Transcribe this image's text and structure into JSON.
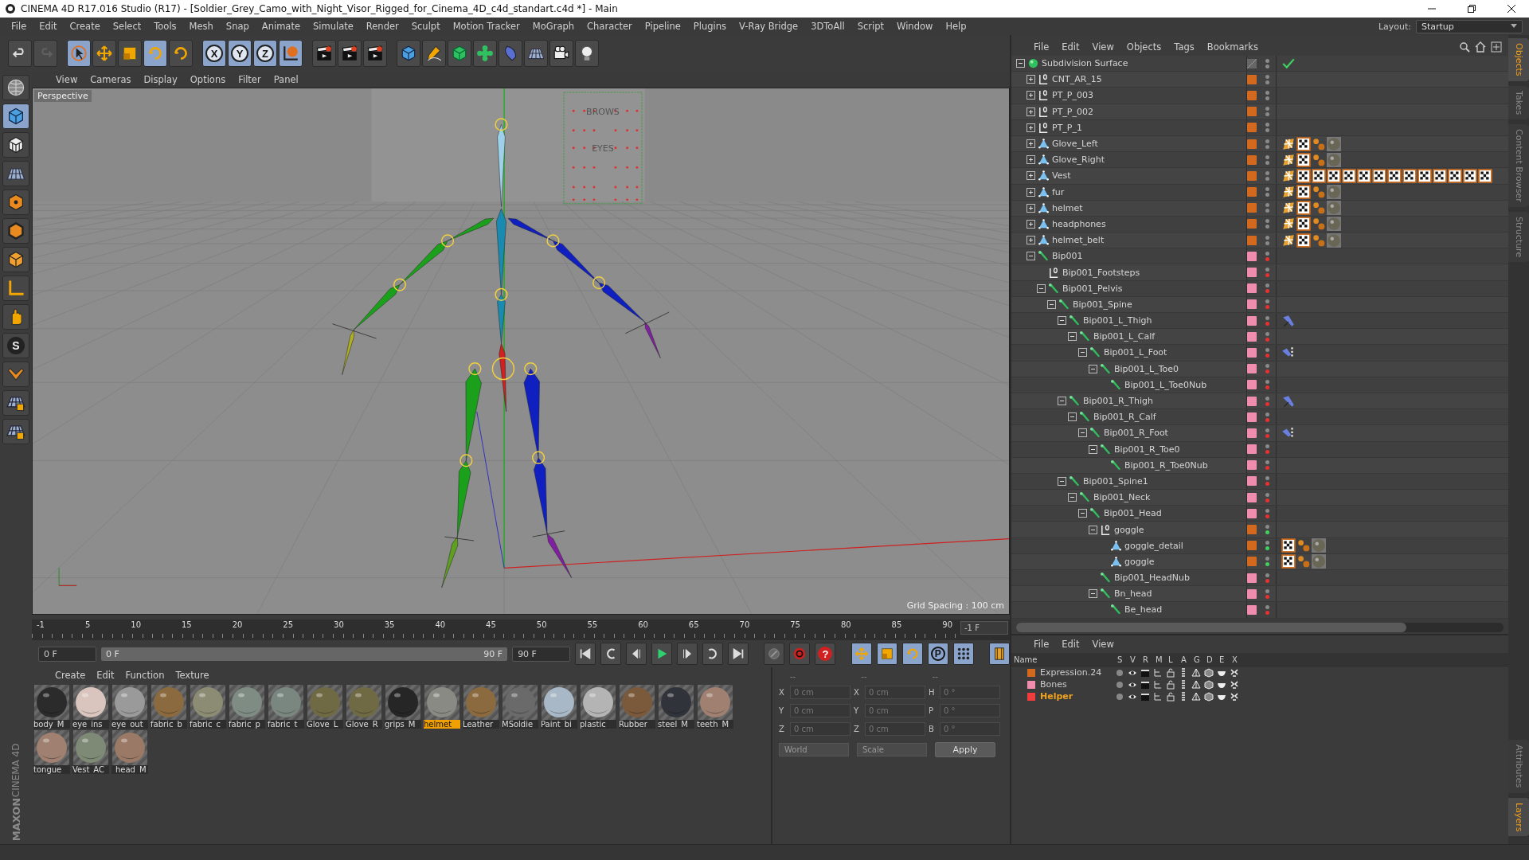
{
  "window": {
    "title": "CINEMA 4D R17.016 Studio (R17) - [Soldier_Grey_Camo_with_Night_Visor_Rigged_for_Cinema_4D_c4d_standart.c4d *] - Main"
  },
  "menu": [
    "File",
    "Edit",
    "Create",
    "Select",
    "Tools",
    "Mesh",
    "Snap",
    "Animate",
    "Simulate",
    "Render",
    "Sculpt",
    "Motion Tracker",
    "MoGraph",
    "Character",
    "Pipeline",
    "Plugins",
    "V-Ray Bridge",
    "3DToAll",
    "Script",
    "Window",
    "Help"
  ],
  "layout": {
    "label": "Layout:",
    "value": "Startup"
  },
  "toolbar": [
    {
      "kind": "undo",
      "selected": false
    },
    {
      "kind": "redo",
      "selected": false,
      "disabled": true
    },
    {
      "kind": "sep"
    },
    {
      "kind": "select",
      "selected": true
    },
    {
      "kind": "move",
      "selected": false
    },
    {
      "kind": "scale",
      "selected": false
    },
    {
      "kind": "rotate",
      "selected": true
    },
    {
      "kind": "rotate",
      "selected": false
    },
    {
      "kind": "sep"
    },
    {
      "kind": "axis",
      "label": "X",
      "selected": true
    },
    {
      "kind": "axis",
      "label": "Y",
      "selected": true
    },
    {
      "kind": "axis",
      "label": "Z",
      "selected": true
    },
    {
      "kind": "world",
      "selected": true
    },
    {
      "kind": "sep"
    },
    {
      "kind": "render",
      "selected": false
    },
    {
      "kind": "render",
      "selected": false
    },
    {
      "kind": "render",
      "selected": false
    },
    {
      "kind": "sep"
    },
    {
      "kind": "cube",
      "selected": false
    },
    {
      "kind": "pen",
      "selected": false
    },
    {
      "kind": "subdivision",
      "selected": false
    },
    {
      "kind": "cloner",
      "selected": false
    },
    {
      "kind": "deformer",
      "selected": false
    },
    {
      "kind": "floor",
      "selected": false
    },
    {
      "kind": "camera",
      "selected": false
    },
    {
      "kind": "light",
      "selected": false
    }
  ],
  "left_tools": [
    {
      "kind": "globe",
      "selected": false
    },
    {
      "kind": "cube",
      "selected": true
    },
    {
      "kind": "checker",
      "selected": false
    },
    {
      "kind": "floor",
      "selected": false
    },
    {
      "kind": "points",
      "selected": false
    },
    {
      "kind": "edges",
      "selected": false
    },
    {
      "kind": "polygons",
      "selected": false
    },
    {
      "kind": "axis-l",
      "selected": false
    },
    {
      "kind": "tweak",
      "selected": false
    },
    {
      "kind": "snap",
      "label": "S",
      "selected": false
    },
    {
      "kind": "magnet",
      "selected": false
    },
    {
      "kind": "grid-lock",
      "selected": false
    },
    {
      "kind": "grid-lock",
      "selected": false
    }
  ],
  "viewport": {
    "menu": [
      "View",
      "Cameras",
      "Display",
      "Options",
      "Filter",
      "Panel"
    ],
    "camera": "Perspective",
    "grid_spacing": "Grid Spacing : 100 cm",
    "rig_labels": [
      "BROWS",
      "EYES"
    ]
  },
  "timeline": {
    "ticks": [
      "-1",
      "5",
      "10",
      "15",
      "20",
      "25",
      "30",
      "35",
      "40",
      "45",
      "50",
      "55",
      "60",
      "65",
      "70",
      "75",
      "80",
      "85",
      "90"
    ],
    "current": "-1 F",
    "start": "0 F",
    "range_start": "0 F",
    "range_end": "90 F",
    "end": "90 F"
  },
  "transport": [
    {
      "kind": "first",
      "selected": false
    },
    {
      "kind": "prev-key",
      "selected": false
    },
    {
      "kind": "prev",
      "selected": false
    },
    {
      "kind": "play",
      "selected": false
    },
    {
      "kind": "next",
      "selected": false
    },
    {
      "kind": "next-key",
      "selected": false
    },
    {
      "kind": "last",
      "selected": false
    },
    {
      "kind": "sep"
    },
    {
      "kind": "key",
      "selected": false
    },
    {
      "kind": "record",
      "selected": false
    },
    {
      "kind": "autokey",
      "label": "?",
      "selected": false
    },
    {
      "kind": "sep"
    },
    {
      "kind": "move",
      "selected": true
    },
    {
      "kind": "scale",
      "selected": true
    },
    {
      "kind": "rotate",
      "selected": true
    },
    {
      "kind": "param",
      "label": "P",
      "selected": true
    },
    {
      "kind": "dots",
      "selected": true
    },
    {
      "kind": "sep"
    },
    {
      "kind": "film",
      "selected": true
    }
  ],
  "materials": {
    "menu": [
      "Create",
      "Edit",
      "Function",
      "Texture"
    ],
    "items": [
      {
        "name": "body_M",
        "color": "#2b2b2b",
        "selected": false
      },
      {
        "name": "eye_ins_",
        "color": "#d9c5bd",
        "selected": false
      },
      {
        "name": "eye_out",
        "color": "#9a9a9a",
        "selected": false
      },
      {
        "name": "fabric_b",
        "color": "#8a6a3e",
        "selected": false
      },
      {
        "name": "fabric_c",
        "color": "#8c8c74",
        "selected": false
      },
      {
        "name": "fabric_p",
        "color": "#7e8c84",
        "selected": false
      },
      {
        "name": "fabric_t",
        "color": "#7a8680",
        "selected": false
      },
      {
        "name": "Glove_L",
        "color": "#6f6a44",
        "selected": false
      },
      {
        "name": "Glove_R",
        "color": "#6f6a44",
        "selected": false
      },
      {
        "name": "grips_M",
        "color": "#262626",
        "selected": false
      },
      {
        "name": "helmet_",
        "color": "#8a8a84",
        "selected": true
      },
      {
        "name": "Leather_",
        "color": "#8a6a3e",
        "selected": false
      },
      {
        "name": "MSoldie",
        "color": "#6a6a6a",
        "selected": false
      },
      {
        "name": "Paint_bi",
        "color": "#a9b8c6",
        "selected": false
      },
      {
        "name": "plastic_",
        "color": "#b4b4b4",
        "selected": false
      },
      {
        "name": "Rubber_",
        "color": "#7a5a3a",
        "selected": false
      },
      {
        "name": "steel_M",
        "color": "#30343a",
        "selected": false
      },
      {
        "name": "teeth_M",
        "color": "#a08070",
        "selected": false
      },
      {
        "name": "tongue_",
        "color": "#a08070",
        "selected": false
      },
      {
        "name": "Vest_AC",
        "color": "#7e8a76",
        "selected": false
      },
      {
        "name": "_head_M",
        "color": "#9a7a66",
        "selected": false
      }
    ]
  },
  "coordinates": {
    "headers": [
      "--",
      "--",
      "--"
    ],
    "rows": [
      {
        "axis": "X",
        "position": "0 cm",
        "size_axis": "X",
        "size": "0 cm",
        "rotation_axis": "H",
        "rotation": "0 °"
      },
      {
        "axis": "Y",
        "position": "0 cm",
        "size_axis": "Y",
        "size": "0 cm",
        "rotation_axis": "P",
        "rotation": "0 °"
      },
      {
        "axis": "Z",
        "position": "0 cm",
        "size_axis": "Z",
        "size": "0 cm",
        "rotation_axis": "B",
        "rotation": "0 °"
      }
    ],
    "mode": "World",
    "size_mode": "Scale",
    "apply": "Apply"
  },
  "objects": {
    "menu": [
      "File",
      "Edit",
      "View",
      "Objects",
      "Tags",
      "Bookmarks"
    ],
    "tree": [
      {
        "name": "Subdivision Surface",
        "kind": "subdivision",
        "expanded": true,
        "enabled": true,
        "render_dot": {
          "color": "#8a8a8a"
        },
        "children": [
          {
            "name": "CNT_AR_15",
            "kind": "null",
            "expanded": false,
            "color": "#d2691e",
            "render_dot": {
              "color": "#8a8a8a"
            }
          },
          {
            "name": "PT_P_003",
            "kind": "null",
            "expanded": false,
            "color": "#d2691e",
            "render_dot": {
              "color": "#8a8a8a"
            }
          },
          {
            "name": "PT_P_002",
            "kind": "null",
            "expanded": false,
            "color": "#d2691e",
            "render_dot": {
              "color": "#8a8a8a"
            }
          },
          {
            "name": "PT_P_1",
            "kind": "null",
            "expanded": false,
            "color": "#d2691e",
            "render_dot": {
              "color": "#8a8a8a"
            }
          },
          {
            "name": "Glove_Left",
            "kind": "polygon",
            "expanded": false,
            "color": "#d2691e",
            "render_dot": {
              "color": "#8a8a8a"
            },
            "tags": [
              {
                "kind": "phong"
              },
              {
                "kind": "texture"
              },
              {
                "kind": "vertex"
              },
              {
                "kind": "material"
              }
            ]
          },
          {
            "name": "Glove_Right",
            "kind": "polygon",
            "expanded": false,
            "color": "#d2691e",
            "render_dot": {
              "color": "#8a8a8a"
            },
            "tags": [
              {
                "kind": "phong"
              },
              {
                "kind": "texture"
              },
              {
                "kind": "vertex"
              },
              {
                "kind": "material"
              }
            ]
          },
          {
            "name": "Vest",
            "kind": "polygon",
            "expanded": false,
            "color": "#d2691e",
            "render_dot": {
              "color": "#8a8a8a"
            },
            "tags": [
              {
                "kind": "phong"
              },
              {
                "kind": "texture"
              },
              {
                "kind": "texture"
              },
              {
                "kind": "texture"
              },
              {
                "kind": "texture"
              },
              {
                "kind": "texture"
              },
              {
                "kind": "texture"
              },
              {
                "kind": "texture"
              },
              {
                "kind": "texture"
              },
              {
                "kind": "texture"
              },
              {
                "kind": "texture"
              },
              {
                "kind": "texture"
              },
              {
                "kind": "texture"
              },
              {
                "kind": "texture"
              }
            ]
          },
          {
            "name": "fur",
            "kind": "polygon",
            "expanded": false,
            "color": "#d2691e",
            "render_dot": {
              "color": "#8a8a8a"
            },
            "tags": [
              {
                "kind": "phong"
              },
              {
                "kind": "texture"
              },
              {
                "kind": "vertex"
              },
              {
                "kind": "material"
              }
            ]
          },
          {
            "name": "helmet",
            "kind": "polygon",
            "expanded": false,
            "color": "#d2691e",
            "render_dot": {
              "color": "#8a8a8a"
            },
            "tags": [
              {
                "kind": "phong"
              },
              {
                "kind": "texture"
              },
              {
                "kind": "vertex"
              },
              {
                "kind": "material"
              }
            ]
          },
          {
            "name": "headphones",
            "kind": "polygon",
            "expanded": false,
            "color": "#d2691e",
            "render_dot": {
              "color": "#8a8a8a"
            },
            "tags": [
              {
                "kind": "phong"
              },
              {
                "kind": "texture"
              },
              {
                "kind": "vertex"
              },
              {
                "kind": "material"
              }
            ]
          },
          {
            "name": "helmet_belt",
            "kind": "polygon",
            "expanded": false,
            "color": "#d2691e",
            "render_dot": {
              "color": "#8a8a8a"
            },
            "tags": [
              {
                "kind": "phong"
              },
              {
                "kind": "texture"
              },
              {
                "kind": "vertex"
              },
              {
                "kind": "material"
              }
            ]
          },
          {
            "name": "Bip001",
            "kind": "bone",
            "expanded": true,
            "color": "#f08cae",
            "render_dot": {
              "color": "#e83030"
            },
            "children": [
              {
                "name": "Bip001_Footsteps",
                "kind": "null",
                "color": "#f08cae",
                "render_dot": {
                  "color": "#e83030"
                }
              },
              {
                "name": "Bip001_Pelvis",
                "kind": "bone",
                "expanded": true,
                "color": "#f08cae",
                "render_dot": {
                  "color": "#e83030"
                },
                "children": [
                  {
                    "name": "Bip001_Spine",
                    "kind": "bone",
                    "expanded": true,
                    "color": "#f08cae",
                    "render_dot": {
                      "color": "#e83030"
                    },
                    "children": [
                      {
                        "name": "Bip001_L_Thigh",
                        "kind": "bone",
                        "expanded": true,
                        "color": "#f08cae",
                        "render_dot": {
                          "color": "#e83030"
                        },
                        "tags": [
                          {
                            "kind": "ik"
                          }
                        ],
                        "children": [
                          {
                            "name": "Bip001_L_Calf",
                            "kind": "bone",
                            "expanded": true,
                            "color": "#f08cae",
                            "render_dot": {
                              "color": "#e83030"
                            },
                            "children": [
                              {
                                "name": "Bip001_L_Foot",
                                "kind": "bone",
                                "expanded": true,
                                "color": "#f08cae",
                                "render_dot": {
                                  "color": "#e83030"
                                },
                                "tags": [
                                  {
                                    "kind": "psr"
                                  }
                                ],
                                "children": [
                                  {
                                    "name": "Bip001_L_Toe0",
                                    "kind": "bone",
                                    "expanded": true,
                                    "color": "#f08cae",
                                    "render_dot": {
                                      "color": "#e83030"
                                    },
                                    "children": [
                                      {
                                        "name": "Bip001_L_Toe0Nub",
                                        "kind": "bone",
                                        "color": "#f08cae",
                                        "render_dot": {
                                          "color": "#e83030"
                                        }
                                      }
                                    ]
                                  }
                                ]
                              }
                            ]
                          }
                        ]
                      },
                      {
                        "name": "Bip001_R_Thigh",
                        "kind": "bone",
                        "expanded": true,
                        "color": "#f08cae",
                        "render_dot": {
                          "color": "#e83030"
                        },
                        "tags": [
                          {
                            "kind": "ik"
                          }
                        ],
                        "children": [
                          {
                            "name": "Bip001_R_Calf",
                            "kind": "bone",
                            "expanded": true,
                            "color": "#f08cae",
                            "render_dot": {
                              "color": "#e83030"
                            },
                            "children": [
                              {
                                "name": "Bip001_R_Foot",
                                "kind": "bone",
                                "expanded": true,
                                "color": "#f08cae",
                                "render_dot": {
                                  "color": "#e83030"
                                },
                                "tags": [
                                  {
                                    "kind": "psr"
                                  }
                                ],
                                "children": [
                                  {
                                    "name": "Bip001_R_Toe0",
                                    "kind": "bone",
                                    "expanded": true,
                                    "color": "#f08cae",
                                    "render_dot": {
                                      "color": "#e83030"
                                    },
                                    "children": [
                                      {
                                        "name": "Bip001_R_Toe0Nub",
                                        "kind": "bone",
                                        "color": "#f08cae",
                                        "render_dot": {
                                          "color": "#e83030"
                                        }
                                      }
                                    ]
                                  }
                                ]
                              }
                            ]
                          }
                        ]
                      },
                      {
                        "name": "Bip001_Spine1",
                        "kind": "bone",
                        "expanded": true,
                        "color": "#f08cae",
                        "render_dot": {
                          "color": "#e83030"
                        },
                        "children": [
                          {
                            "name": "Bip001_Neck",
                            "kind": "bone",
                            "expanded": true,
                            "color": "#f08cae",
                            "render_dot": {
                              "color": "#e83030"
                            },
                            "children": [
                              {
                                "name": "Bip001_Head",
                                "kind": "bone",
                                "expanded": true,
                                "color": "#f08cae",
                                "render_dot": {
                                  "color": "#e83030"
                                },
                                "children": [
                                  {
                                    "name": "goggle",
                                    "kind": "null",
                                    "expanded": true,
                                    "color": "#d2691e",
                                    "render_dot": {
                                      "color": "#40d060"
                                    },
                                    "children": [
                                      {
                                        "name": "goggle_detail",
                                        "kind": "polygon",
                                        "color": "#d2691e",
                                        "render_dot": {
                                          "color": "#40d060"
                                        },
                                        "tags": [
                                          {
                                            "kind": "texture"
                                          },
                                          {
                                            "kind": "vertex"
                                          },
                                          {
                                            "kind": "material"
                                          }
                                        ]
                                      },
                                      {
                                        "name": "goggle",
                                        "kind": "polygon",
                                        "color": "#d2691e",
                                        "render_dot": {
                                          "color": "#40d060"
                                        },
                                        "tags": [
                                          {
                                            "kind": "texture"
                                          },
                                          {
                                            "kind": "vertex"
                                          },
                                          {
                                            "kind": "material"
                                          }
                                        ]
                                      }
                                    ]
                                  },
                                  {
                                    "name": "Bip001_HeadNub",
                                    "kind": "bone",
                                    "color": "#f08cae",
                                    "render_dot": {
                                      "color": "#e83030"
                                    }
                                  },
                                  {
                                    "name": "Bn_head",
                                    "kind": "bone",
                                    "expanded": true,
                                    "color": "#f08cae",
                                    "render_dot": {
                                      "color": "#e83030"
                                    },
                                    "children": [
                                      {
                                        "name": "Be_head",
                                        "kind": "bone",
                                        "color": "#f08cae",
                                        "render_dot": {
                                          "color": "#e83030"
                                        }
                                      }
                                    ]
                                  }
                                ]
                              }
                            ]
                          }
                        ]
                      }
                    ]
                  }
                ]
              }
            ]
          }
        ]
      }
    ]
  },
  "layers": {
    "menu": [
      "File",
      "Edit",
      "View"
    ],
    "columns": [
      "Name",
      "S",
      "V",
      "R",
      "M",
      "L",
      "A",
      "G",
      "D",
      "E",
      "X"
    ],
    "rows": [
      {
        "name": "Expression.24",
        "color": "#d2691e",
        "selected": false
      },
      {
        "name": "Bones",
        "color": "#f08cae",
        "selected": false
      },
      {
        "name": "Helper",
        "color": "#f03c3c",
        "selected": true
      }
    ]
  },
  "side_tabs": [
    {
      "label": "Objects",
      "selected": true
    },
    {
      "label": "Takes",
      "selected": false
    },
    {
      "label": "Content Browser",
      "selected": false
    },
    {
      "label": "Structure",
      "selected": false
    }
  ],
  "side_tabs_lower": [
    {
      "label": "Attributes",
      "selected": false
    },
    {
      "label": "Layers",
      "selected": true
    }
  ],
  "logo": {
    "brand": "MAXON",
    "product": "CINEMA 4D"
  }
}
